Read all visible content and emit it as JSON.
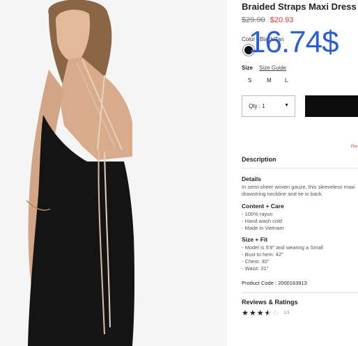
{
  "product": {
    "title": "Braided Straps Maxi Dress",
    "price_old": "$29.90",
    "price_new": "$20.93",
    "overlay_price": "16.74$"
  },
  "color": {
    "label": "Color : Black/Tan",
    "swatch_hex": "#111111"
  },
  "size": {
    "label": "Size",
    "guide_label": "Size Guide",
    "options": [
      "S",
      "M",
      "L"
    ]
  },
  "qty": {
    "label": "Qty : 1"
  },
  "pre_label": "Pre",
  "description": {
    "heading": "Description",
    "details_title": "Details",
    "details_lines": [
      "In semi-sheer woven gauze, this sleeveless maxi",
      "drawstring neckline and tie in back."
    ],
    "content_title": "Content + Care",
    "content_lines": [
      "- 100% rayon",
      "- Hand wash cold",
      "- Made in Vietnam"
    ],
    "fit_title": "Size + Fit",
    "fit_lines": [
      "- Model is 5'8\" and wearing a Small",
      "- Bust to hem: 42\"",
      "- Chest: 30\"",
      "- Waist: 31\""
    ],
    "product_code": "Product Code : 2000163913"
  },
  "reviews": {
    "heading": "Reviews & Ratings",
    "rating": 3.5,
    "rating_label": "3.5"
  },
  "colors": {
    "accent_red": "#e0342b",
    "overlay_blue": "#2a5fd6",
    "button_black": "#0c0c0c"
  }
}
